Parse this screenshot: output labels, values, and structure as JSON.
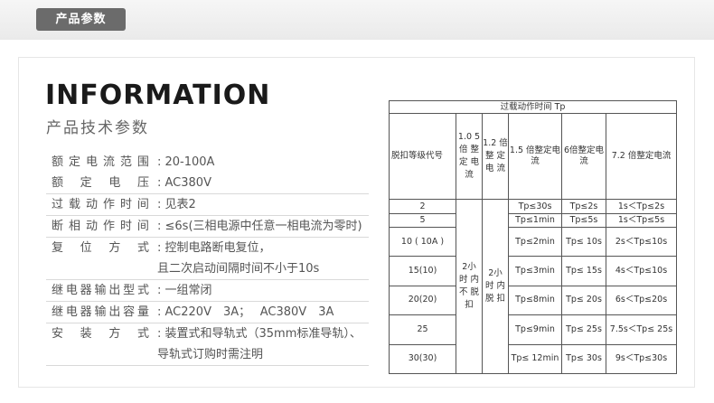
{
  "header": {
    "tab_label": "产品参数"
  },
  "hero": {
    "title": "INFORMATION",
    "subtitle": "产品技术参数"
  },
  "specs": [
    {
      "label": "额定电流范围",
      "value": ": 20-100A"
    },
    {
      "label": "额定电压",
      "value": ": AC380V"
    },
    {
      "label": "过载动作时间",
      "value": ": 见表2"
    },
    {
      "label": "断相动作时间",
      "value": ": ≤6s(三相电源中任意一相电流为零时)"
    },
    {
      "label": "复位方式",
      "value": ": 控制电路断电复位，"
    },
    {
      "label": "",
      "value": "且二次启动间隔时间不小于10s"
    },
    {
      "label": "继电器输出型式",
      "value": ": 一组常闭"
    },
    {
      "label": "继电器输出容量",
      "value": ": AC220V　3A；　 AC380V　3A"
    },
    {
      "label": "安装方式",
      "value": ": 装置式和导轨式（35mm标准导轨）、"
    },
    {
      "label": "",
      "value": "导轨式订购时需注明"
    }
  ],
  "table": {
    "title": "过载动作时间 Tp",
    "headers": {
      "trip_class": "脱扣等级代号",
      "c10": "1.0 5倍 整 定 电 流",
      "c12": "1.2 倍 整 定 电 流",
      "c15": "1.5 倍整定电流",
      "c6": "6倍整定电流",
      "c72": "7.2 倍整定电流"
    },
    "no_trip_10": "2小 时 内 不 脱 扣",
    "no_trip_12": "2小 时 内 脱 扣",
    "rows": [
      {
        "code": "2",
        "c15": "Tp≤30s",
        "c6": "Tp≤2s",
        "c72": "1s＜Tp≤2s"
      },
      {
        "code": "5",
        "c15": "Tp≤1min",
        "c6": "Tp≤5s",
        "c72": "1s＜Tp≤5s"
      },
      {
        "code": "10 ( 10A )",
        "c15": "Tp≤2min",
        "c6": "Tp≤ 10s",
        "c72": "2s＜Tp≤10s"
      },
      {
        "code": "15(10)",
        "c15": "Tp≤3min",
        "c6": "Tp≤ 15s",
        "c72": "4s＜Tp≤10s"
      },
      {
        "code": "20(20)",
        "c15": "Tp≤8min",
        "c6": "Tp≤ 20s",
        "c72": "6s＜Tp≤20s"
      },
      {
        "code": "25",
        "c15": "Tp≤9min",
        "c6": "Tp≤ 25s",
        "c72": "7.5s＜Tp≤ 25s"
      },
      {
        "code": "30(30)",
        "c15": "Tp≤ 12min",
        "c6": "Tp≤ 30s",
        "c72": "9s＜Tp≤30s"
      }
    ]
  }
}
